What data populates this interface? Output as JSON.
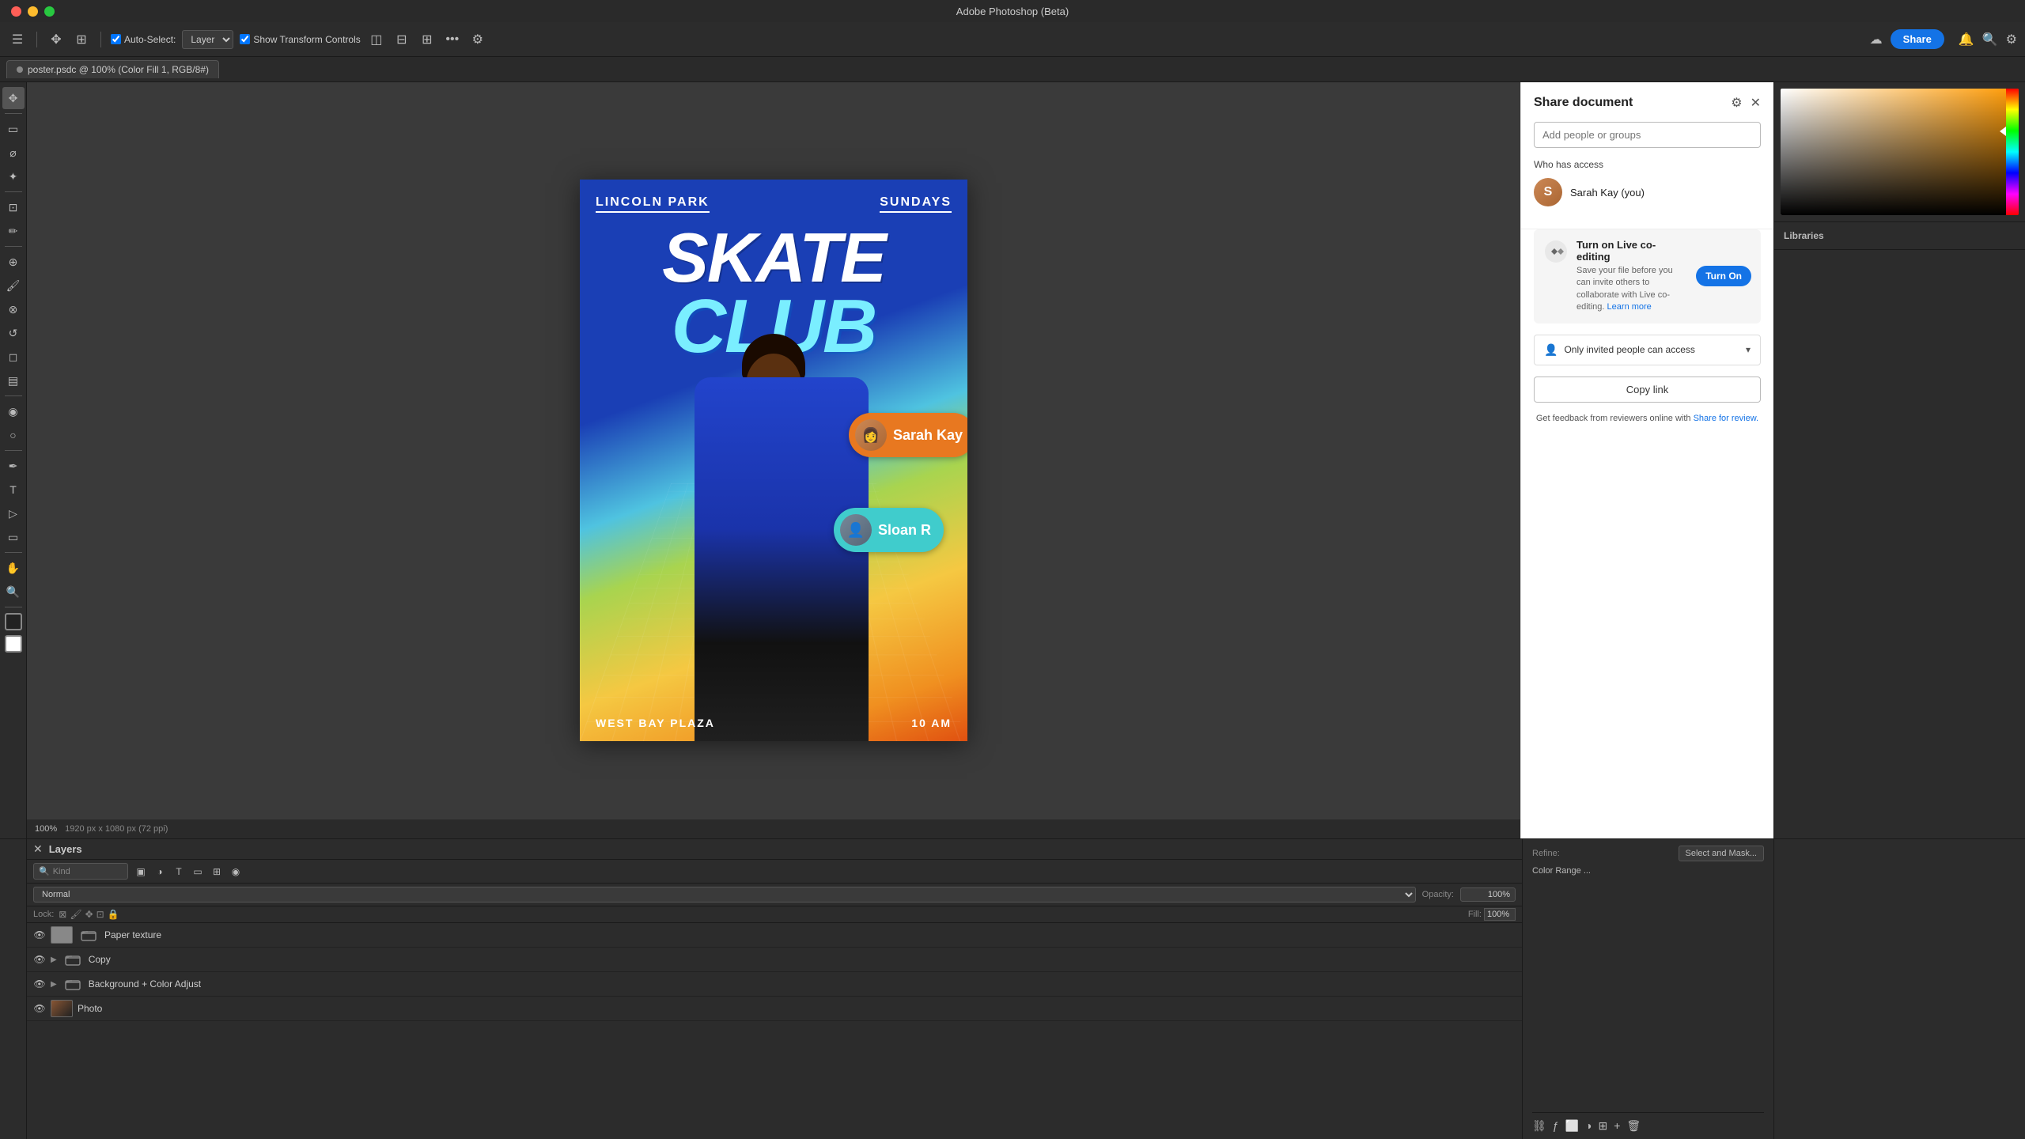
{
  "app": {
    "title": "Adobe Photoshop (Beta)",
    "tab_label": "poster.psdc @ 100% (Color Fill 1, RGB/8#)"
  },
  "toolbar": {
    "auto_select_label": "Auto-Select:",
    "layer_label": "Layer",
    "show_transform": "Show Transform Controls",
    "share_button": "Share"
  },
  "share_panel": {
    "title": "Share document",
    "add_people_placeholder": "Add people or groups",
    "who_has_access": "Who has access",
    "user_name": "Sarah Kay (you)",
    "co_editing_title": "Turn on Live co-editing",
    "co_editing_desc": "Save your file before you can invite others to collaborate with Live co-editing.",
    "learn_more": "Learn more",
    "turn_on_btn": "Turn On",
    "access_label": "Only invited people can access",
    "copy_link_btn": "Copy link",
    "share_review_text": "Get feedback from reviewers online with",
    "share_review_link": "Share for review."
  },
  "canvas": {
    "poster": {
      "location_left": "LINCOLN PARK",
      "day": "SUNDAYS",
      "skate": "SKATE",
      "club": "CLUB",
      "venue": "WEST BAY PLAZA",
      "time": "10 AM"
    },
    "bubbles": {
      "sarah": "Sarah Kay",
      "sloan": "Sloan R"
    },
    "zoom": "100%",
    "dimensions": "1920 px x 1080 px (72 ppi)"
  },
  "layers": {
    "title": "Layers",
    "search_placeholder": "Kind",
    "mode": "Normal",
    "opacity_label": "Opacity:",
    "opacity_value": "100%",
    "lock_label": "Lock:",
    "fill_label": "Fill:",
    "fill_value": "100%",
    "items": [
      {
        "name": "Paper texture",
        "visible": true,
        "type": "layer"
      },
      {
        "name": "Copy",
        "visible": true,
        "type": "folder"
      },
      {
        "name": "Background + Color Adjust",
        "visible": true,
        "type": "folder"
      },
      {
        "name": "Photo",
        "visible": true,
        "type": "layer"
      }
    ]
  },
  "right_panel": {
    "refine_label": "Refine:",
    "select_mask_btn": "Select and Mask...",
    "color_range_btn": "Color Range ..."
  }
}
